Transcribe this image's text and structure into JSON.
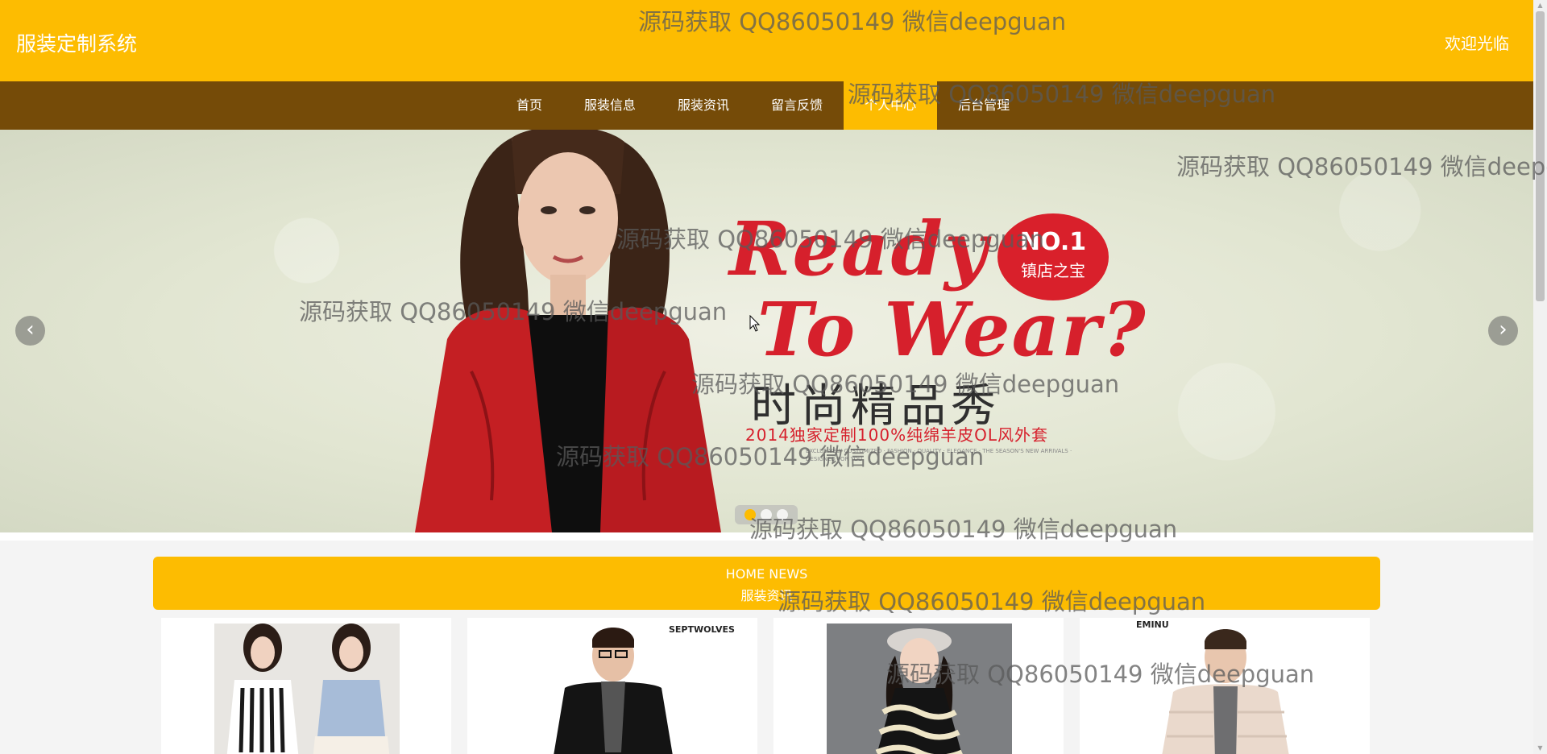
{
  "header": {
    "brand": "服装定制系统",
    "welcome": "欢迎光临"
  },
  "nav": {
    "items": [
      {
        "label": "首页",
        "active": false
      },
      {
        "label": "服装信息",
        "active": false
      },
      {
        "label": "服装资讯",
        "active": false
      },
      {
        "label": "留言反馈",
        "active": false
      },
      {
        "label": "个人中心",
        "active": true
      },
      {
        "label": "后台管理",
        "active": false
      }
    ]
  },
  "banner": {
    "headline_line1": "Ready",
    "headline_line2": "To Wear?",
    "badge_title": "NO.1",
    "badge_sub": "镇店之宝",
    "collection_title": "时尚精品秀",
    "collection_sub": "2014独家定制100%纯绵羊皮OL风外套",
    "fine_print": "EXCLUSIVELY CUSTOMIZED · FASHION · QUALITY · ELEGANCE · THE SEASON'S NEW ARRIVALS · DESIGNED FOR YOU",
    "prev_glyph": "‹",
    "next_glyph": "›",
    "slide_count": 3,
    "active_slide": 1
  },
  "news": {
    "title_en": "HOME NEWS",
    "title_cn": "服装资讯",
    "cards": [
      {
        "label": "striped-lace-tops"
      },
      {
        "label": "mens-black-coat",
        "brand_tag": "SEPTWOLVES"
      },
      {
        "label": "girls-knit-dress"
      },
      {
        "label": "mens-puffer-jacket",
        "brand_tag": "EMINU"
      }
    ]
  },
  "watermark": {
    "text": "源码获取 QQ86050149 微信deepguan"
  },
  "colors": {
    "primary": "#fdbc01",
    "nav_bg": "#754b08",
    "accent_red": "#d6202c"
  }
}
